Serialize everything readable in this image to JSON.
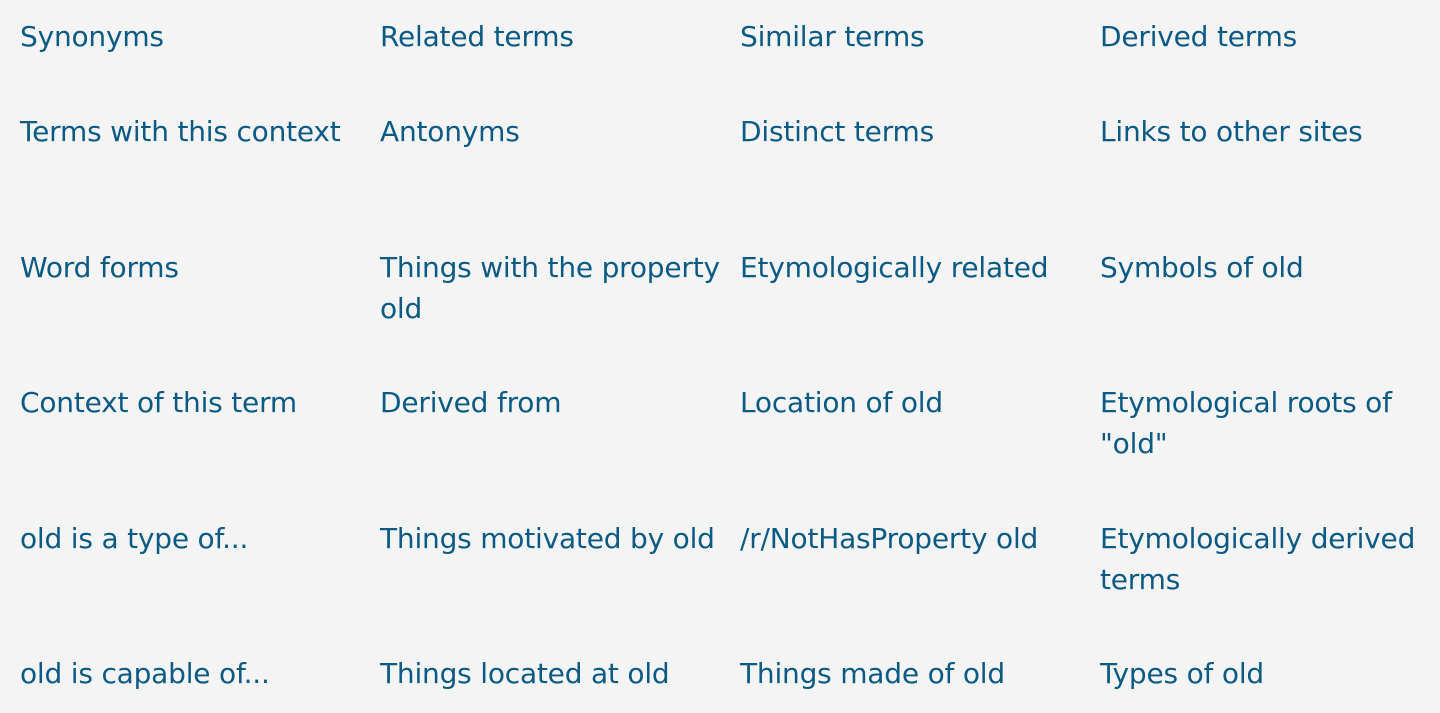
{
  "links": {
    "synonyms": "Synonyms",
    "related_terms": "Related terms",
    "similar_terms": "Similar terms",
    "derived_terms": "Derived terms",
    "terms_with_this_context": "Terms with this context",
    "antonyms": "Antonyms",
    "distinct_terms": "Distinct terms",
    "links_to_other_sites": "Links to other sites",
    "word_forms": "Word forms",
    "things_with_property": "Things with the property old",
    "etymologically_related": "Etymologically related",
    "symbols_of": "Symbols of old",
    "context_of_this_term": "Context of this term",
    "derived_from": "Derived from",
    "location_of": "Location of old",
    "etymological_roots": "Etymological roots of \"old\"",
    "is_a_type_of": "old is a type of...",
    "things_motivated_by": "Things motivated by old",
    "not_has_property": "/r/NotHasProperty old",
    "etymologically_derived_terms": "Etymologically derived terms",
    "is_capable_of": "old is capable of...",
    "things_located_at": "Things located at old",
    "things_made_of": "Things made of old",
    "types_of": "Types of old"
  }
}
